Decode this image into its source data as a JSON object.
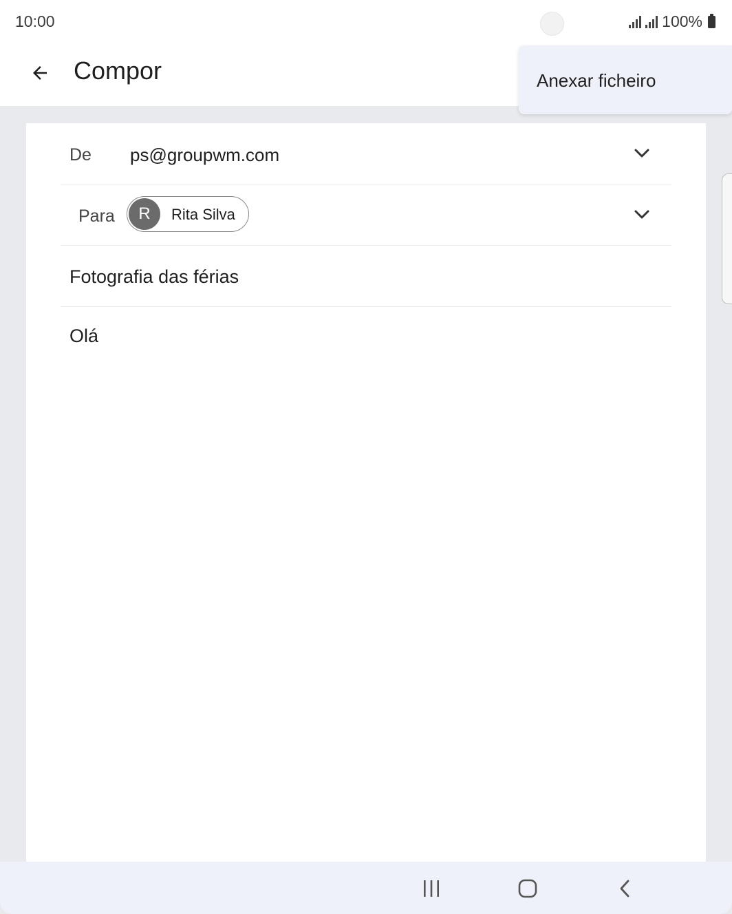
{
  "status_bar": {
    "time": "10:00",
    "battery_text": "100%",
    "icons": [
      "signal-icon",
      "signal-icon",
      "battery-icon"
    ]
  },
  "app_bar": {
    "title": "Compor",
    "back_icon": "arrow-back-icon"
  },
  "menu": {
    "items": [
      {
        "label": "Anexar ficheiro"
      }
    ]
  },
  "compose": {
    "from_label": "De",
    "from_value": "ps@groupwm.com",
    "to_label": "Para",
    "recipients": [
      {
        "initial": "R",
        "name": "Rita Silva"
      }
    ],
    "subject": "Fotografia das férias",
    "body": "Olá"
  },
  "nav_bar": {
    "buttons": [
      "recent-apps-icon",
      "home-icon",
      "back-icon"
    ]
  },
  "colors": {
    "background": "#e9eaee",
    "menu_bg": "#eef1f9",
    "avatar_bg": "#6b6b6b"
  }
}
